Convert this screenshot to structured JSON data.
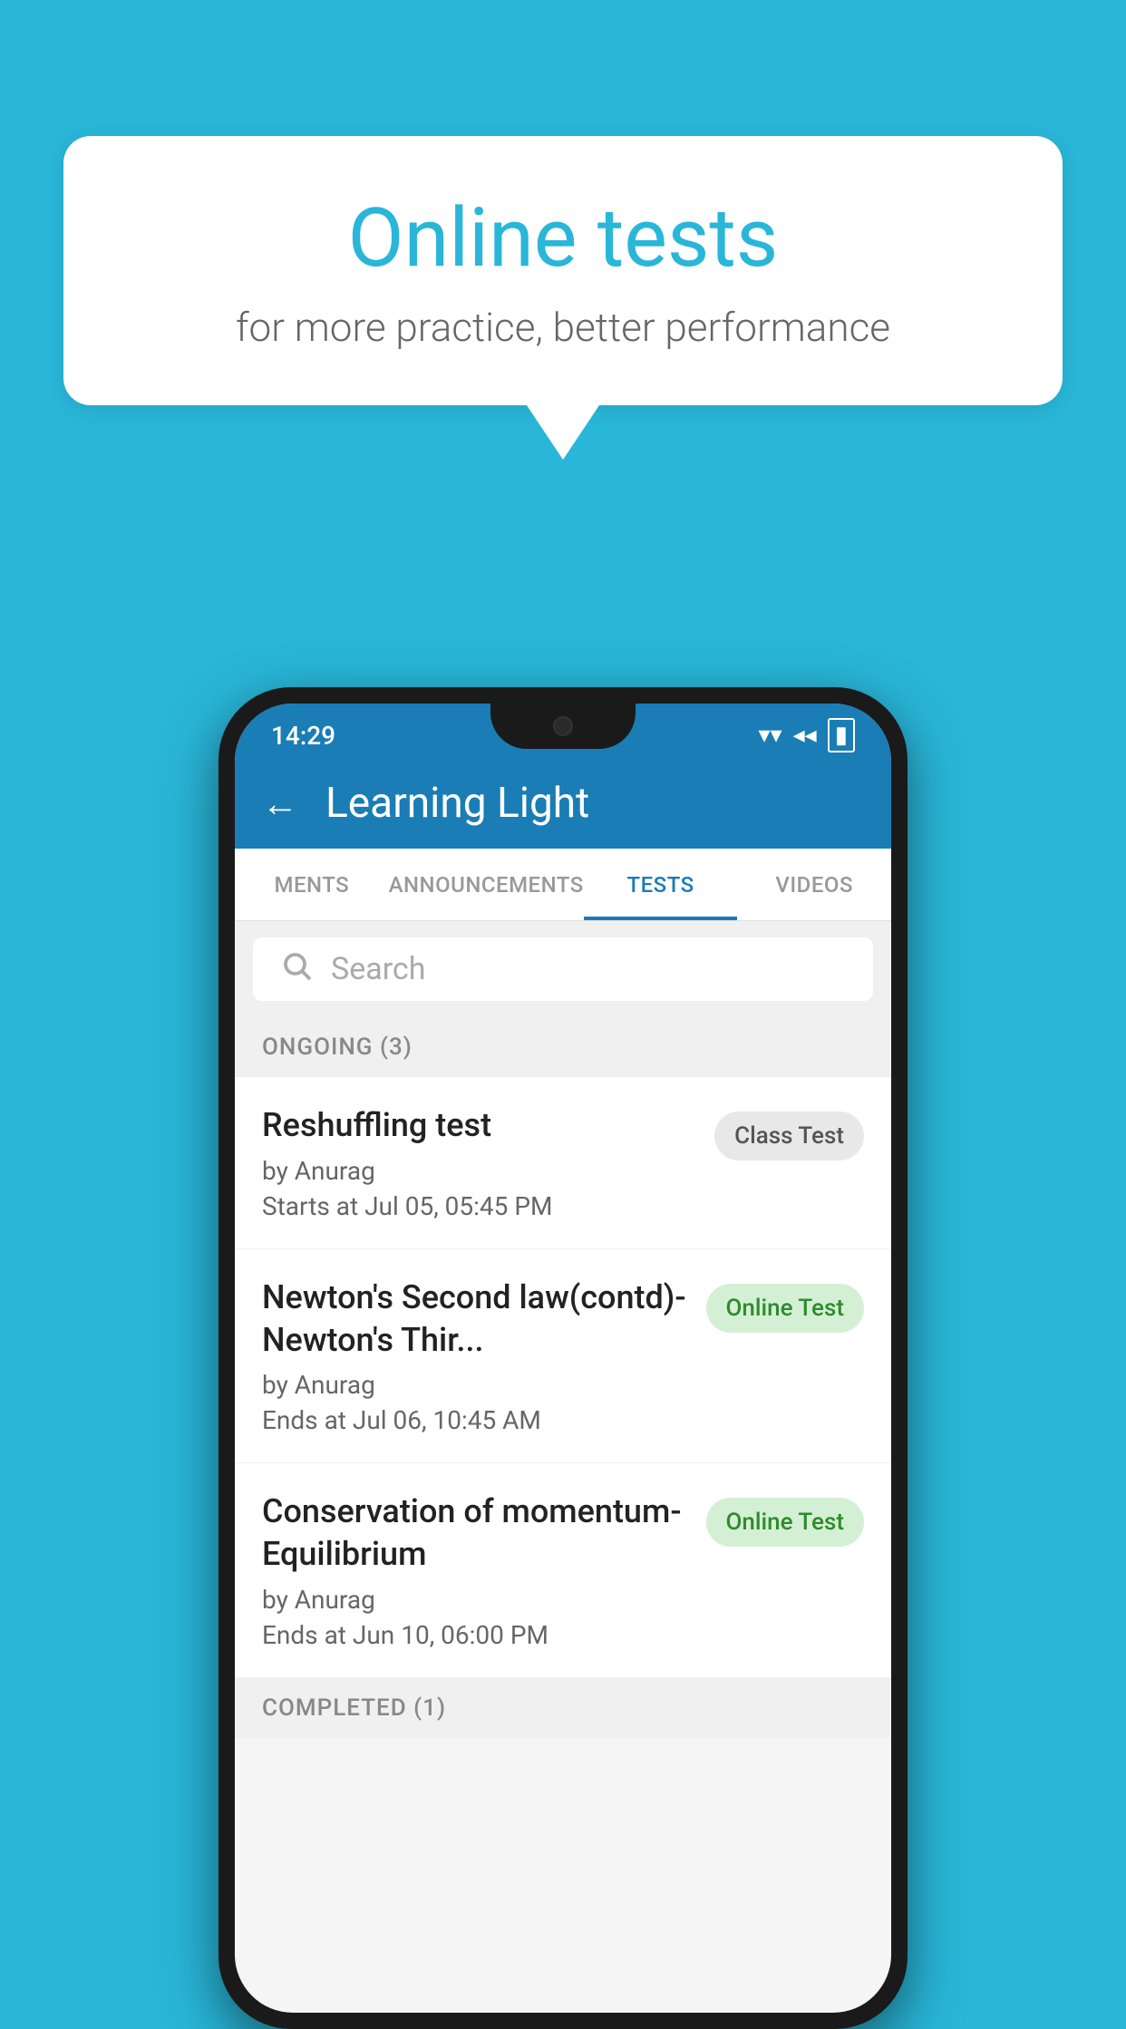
{
  "background": {
    "color": "#29b6d8"
  },
  "speech_bubble": {
    "title": "Online tests",
    "subtitle": "for more practice, better performance"
  },
  "phone": {
    "status_bar": {
      "time": "14:29",
      "wifi_icon": "▼",
      "signal_icon": "◀",
      "battery_icon": "▮"
    },
    "header": {
      "back_label": "←",
      "title": "Learning Light"
    },
    "tabs": [
      {
        "label": "MENTS",
        "active": false
      },
      {
        "label": "ANNOUNCEMENTS",
        "active": false
      },
      {
        "label": "TESTS",
        "active": true
      },
      {
        "label": "VIDEOS",
        "active": false
      }
    ],
    "search": {
      "placeholder": "Search"
    },
    "sections": [
      {
        "title": "ONGOING (3)",
        "tests": [
          {
            "name": "Reshuffling test",
            "author": "by Anurag",
            "time_label": "Starts at",
            "time": "Jul 05, 05:45 PM",
            "badge": "Class Test",
            "badge_type": "class"
          },
          {
            "name": "Newton's Second law(contd)-Newton's Thir...",
            "author": "by Anurag",
            "time_label": "Ends at",
            "time": "Jul 06, 10:45 AM",
            "badge": "Online Test",
            "badge_type": "online"
          },
          {
            "name": "Conservation of momentum-Equilibrium",
            "author": "by Anurag",
            "time_label": "Ends at",
            "time": "Jun 10, 06:00 PM",
            "badge": "Online Test",
            "badge_type": "online"
          }
        ]
      },
      {
        "title": "COMPLETED (1)",
        "tests": []
      }
    ]
  }
}
